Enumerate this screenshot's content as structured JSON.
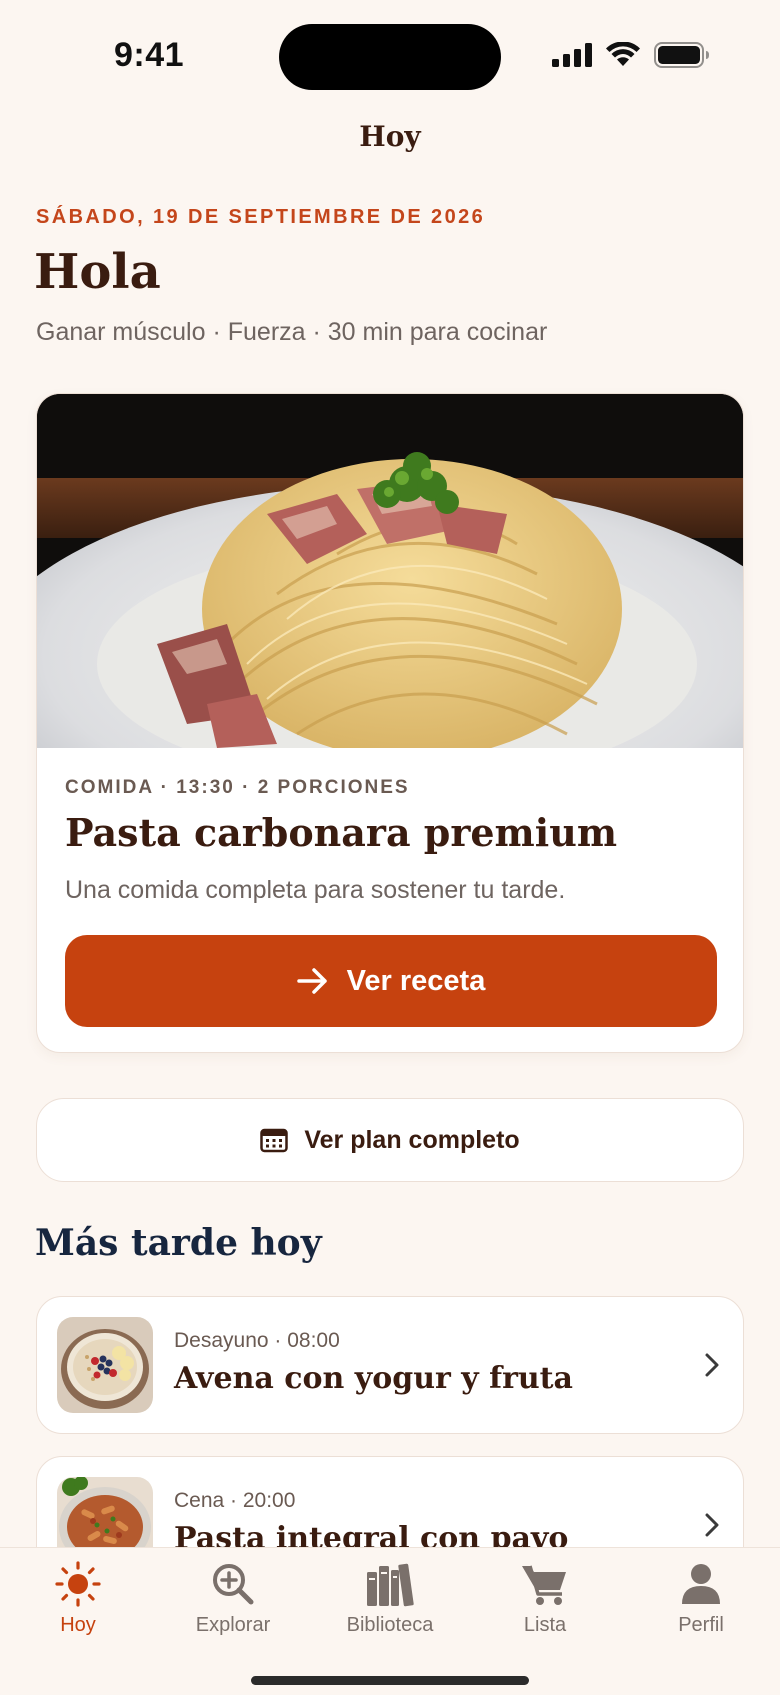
{
  "status_bar": {
    "time": "9:41"
  },
  "nav": {
    "title": "Hoy"
  },
  "header": {
    "date": "SÁBADO, 19 DE SEPTIEMBRE DE 2026",
    "greeting": "Hola",
    "subtitle": "Ganar músculo · Fuerza · 30 min para cocinar"
  },
  "featured": {
    "meta": "COMIDA · 13:30 · 2 PORCIONES",
    "title": "Pasta carbonara premium",
    "description": "Una comida completa para sostener tu tarde.",
    "button_label": "Ver receta",
    "image_icon": "pasta-carbonara-photo"
  },
  "plan_button": {
    "label": "Ver plan completo",
    "icon": "calendar-icon"
  },
  "later_section": {
    "title": "Más tarde hoy",
    "items": [
      {
        "meta": "Desayuno · 08:00",
        "title": "Avena con yogur y fruta",
        "image_icon": "oatmeal-bowl-photo"
      },
      {
        "meta": "Cena · 20:00",
        "title": "Pasta integral con pavo",
        "image_icon": "pasta-turkey-photo"
      }
    ]
  },
  "tab_bar": {
    "active": "Hoy",
    "tabs": [
      {
        "label": "Hoy",
        "icon": "sun-icon"
      },
      {
        "label": "Explorar",
        "icon": "search-icon"
      },
      {
        "label": "Biblioteca",
        "icon": "books-icon"
      },
      {
        "label": "Lista",
        "icon": "cart-icon"
      },
      {
        "label": "Perfil",
        "icon": "person-icon"
      }
    ]
  },
  "colors": {
    "background": "#fcf6f1",
    "accent": "#c6420f",
    "date_accent": "#c4461b",
    "heading": "#3a1c10",
    "section_heading": "#17263f"
  }
}
